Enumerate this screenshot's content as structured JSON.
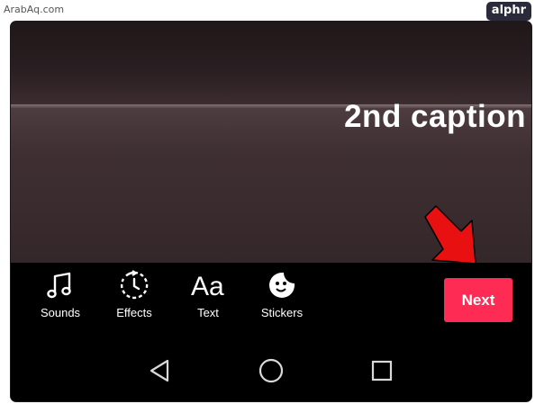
{
  "watermark": {
    "text": "ArabAq.com"
  },
  "brand": {
    "text": "alphr"
  },
  "video": {
    "caption": "2nd caption"
  },
  "toolbar": {
    "items": [
      {
        "label": "Sounds",
        "icon": "music-note-icon"
      },
      {
        "label": "Effects",
        "icon": "timer-effects-icon"
      },
      {
        "label": "Text",
        "icon": "text-aa-icon"
      },
      {
        "label": "Stickers",
        "icon": "sticker-face-icon"
      }
    ],
    "next_label": "Next"
  },
  "navbar": {
    "back": "back-triangle-icon",
    "home": "home-circle-icon",
    "recents": "recents-square-icon"
  },
  "colors": {
    "accent": "#fe2c55",
    "annotation_arrow": "#e81010",
    "background": "#000000"
  }
}
